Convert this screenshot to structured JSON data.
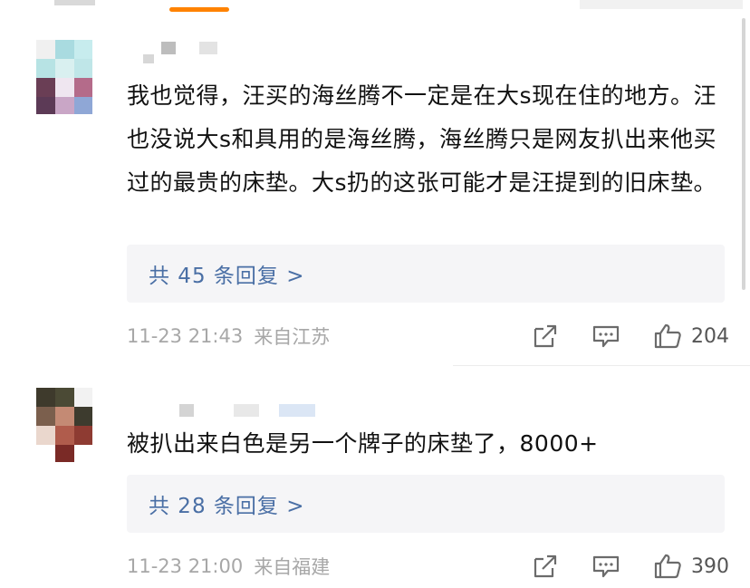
{
  "colors": {
    "accent": "#ff8200",
    "link": "#4a6fa5",
    "meta": "#a7a7a7",
    "reply_box_bg": "#f5f5f7"
  },
  "comments": [
    {
      "text": "我也觉得，汪买的海丝腾不一定是在大s现在住的地方。汪也没说大s和具用的是海丝腾，海丝腾只是网友扒出来他买过的最贵的床垫。大s扔的这张可能才是汪提到的旧床垫。",
      "replies_label": "共 45 条回复 >",
      "time": "11-23 21:43",
      "location": "来自江苏",
      "like_count": "204",
      "avatar_icon": "avatar-icon",
      "share_icon": "share-icon",
      "comment_icon": "comment-icon",
      "like_icon": "thumbs-up-icon"
    },
    {
      "text": "被扒出来白色是另一个牌子的床垫了，8000+",
      "replies_label": "共 28 条回复 >",
      "time": "11-23 21:00",
      "location": "来自福建",
      "like_count": "390",
      "avatar_icon": "avatar-icon",
      "share_icon": "share-icon",
      "comment_icon": "comment-icon",
      "like_icon": "thumbs-up-icon"
    }
  ]
}
